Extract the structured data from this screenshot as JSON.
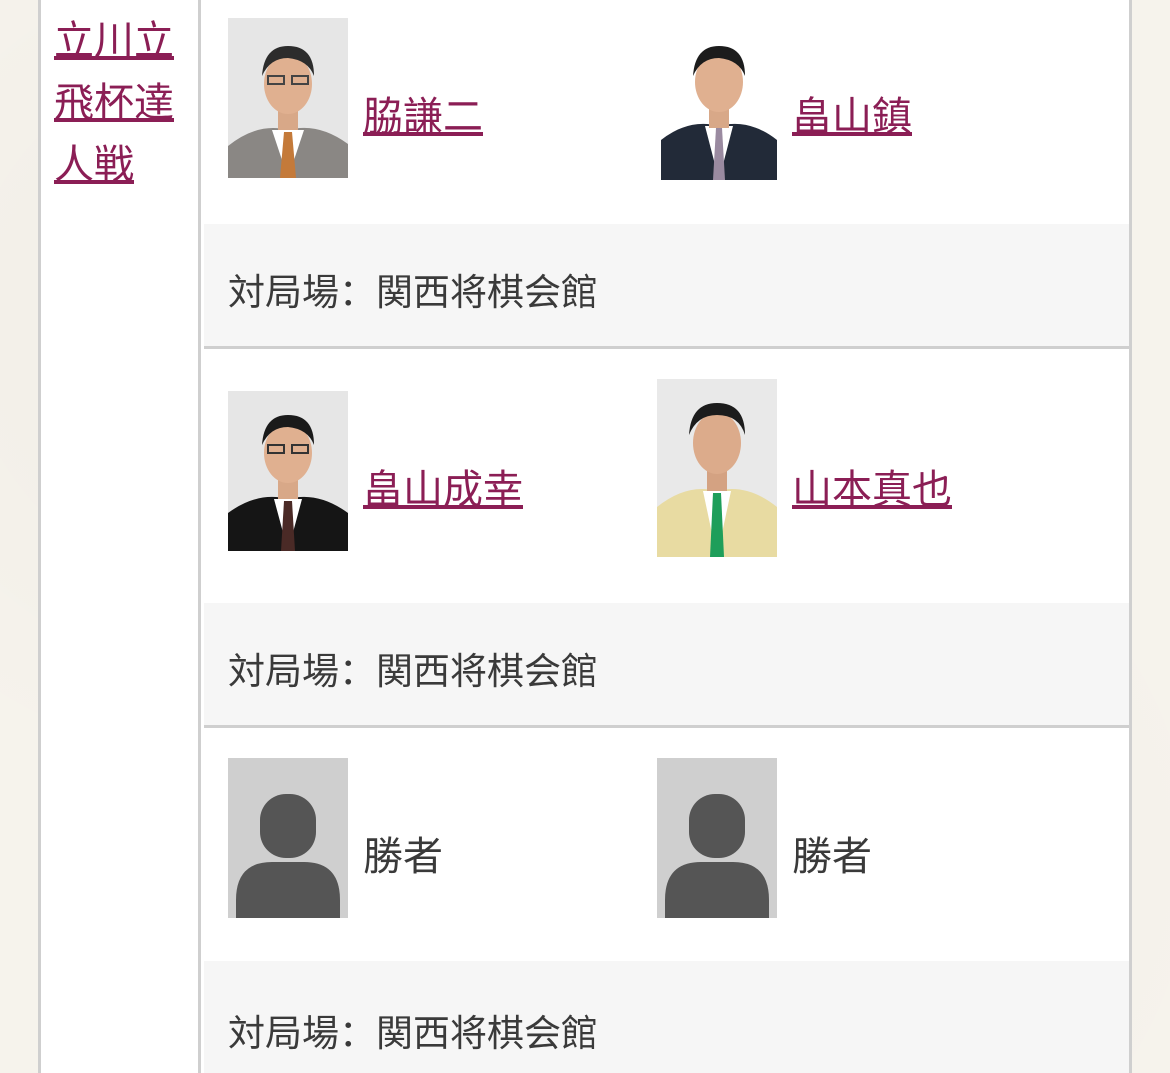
{
  "event": {
    "label": "立川立飛杯達人戦"
  },
  "matches": [
    {
      "player1": {
        "name": "脇謙二",
        "linked": true,
        "photo": "person-photo"
      },
      "player2": {
        "name": "畠山鎮",
        "linked": true,
        "photo": "person-photo"
      },
      "venue": "対局場：関西将棋会館"
    },
    {
      "player1": {
        "name": "畠山成幸",
        "linked": true,
        "photo": "person-photo"
      },
      "player2": {
        "name": "山本真也",
        "linked": true,
        "photo": "person-photo"
      },
      "venue": "対局場：関西将棋会館"
    },
    {
      "player1": {
        "name": "勝者",
        "linked": false,
        "photo": "placeholder-avatar"
      },
      "player2": {
        "name": "勝者",
        "linked": false,
        "photo": "placeholder-avatar"
      },
      "venue": "対局場：関西将棋会館"
    }
  ],
  "colors": {
    "link": "#8b1e55",
    "border": "#cfcfcf",
    "venue_bg": "#f6f6f6",
    "page_bg": "#f6f3ec"
  }
}
